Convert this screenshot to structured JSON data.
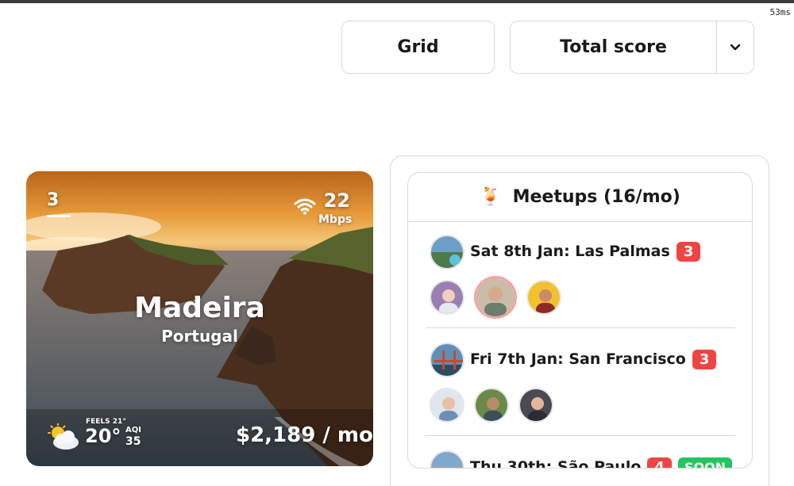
{
  "timing": "53ms",
  "controls": {
    "grid_label": "Grid",
    "sort_label": "Total score"
  },
  "city_card": {
    "rank": "3",
    "internet_speed": "22",
    "internet_unit": "Mbps",
    "city": "Madeira",
    "country": "Portugal",
    "feels_like": "FEELS 21°",
    "temperature": "20°",
    "aqi_label": "AQI",
    "aqi_value": "35",
    "cost": "$2,189 / mo"
  },
  "meetups": {
    "emoji": "🍹",
    "title": "Meetups (16/mo)",
    "events": [
      {
        "title": "Sat 8th Jan: Las Palmas",
        "count": "3",
        "badge": ""
      },
      {
        "title": "Fri 7th Jan: San Francisco",
        "count": "3",
        "badge": ""
      },
      {
        "title": "Thu 30th: São Paulo",
        "count": "4",
        "badge": "SOON"
      }
    ]
  }
}
